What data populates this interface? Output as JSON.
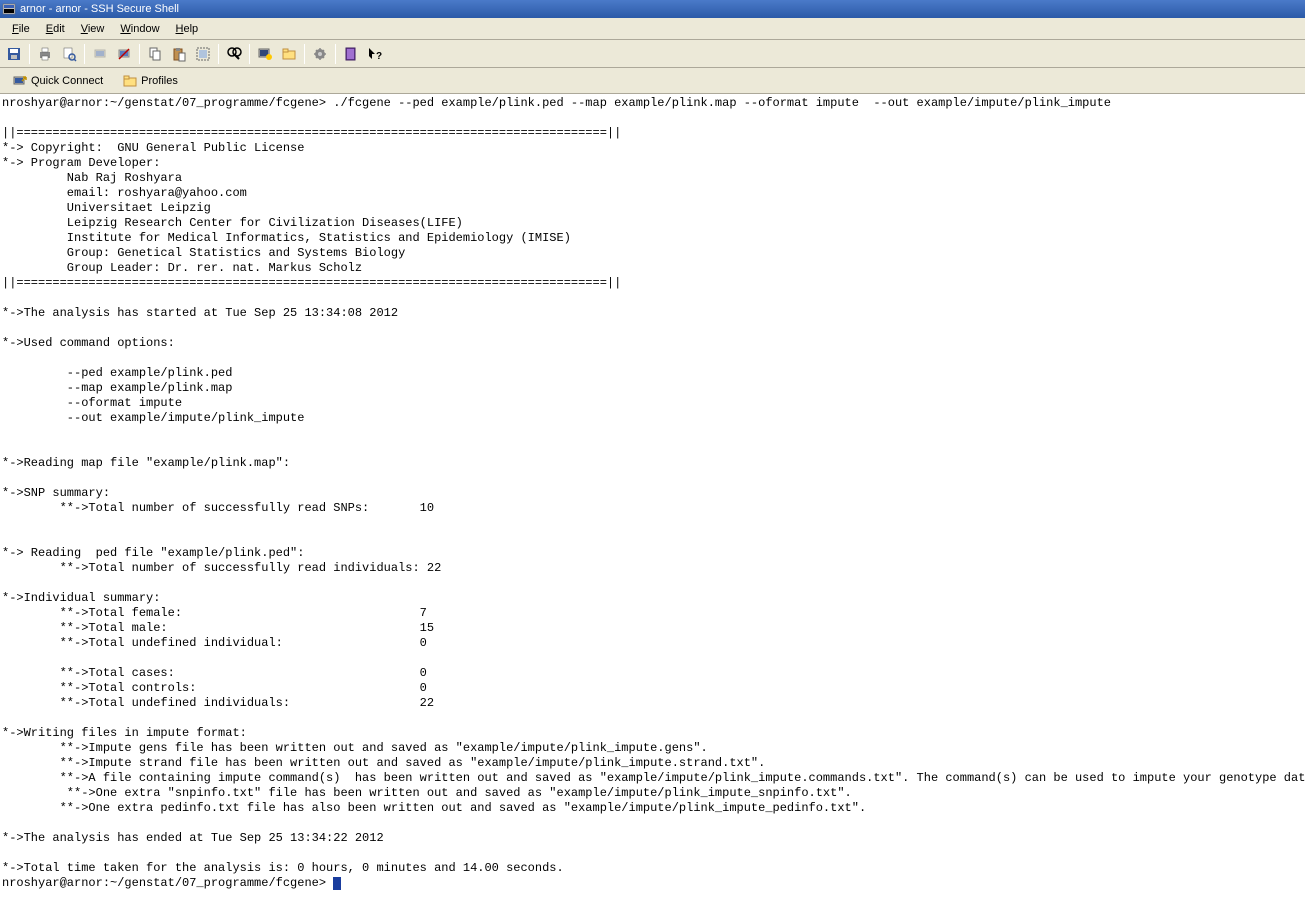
{
  "title": "arnor - arnor - SSH Secure Shell",
  "menu": {
    "file": "File",
    "edit": "Edit",
    "view": "View",
    "window": "Window",
    "help": "Help"
  },
  "toolbar2": {
    "quick_connect": "Quick Connect",
    "profiles": "Profiles"
  },
  "terminal_lines": [
    "nroshyar@arnor:~/genstat/07_programme/fcgene> ./fcgene --ped example/plink.ped --map example/plink.map --oformat impute  --out example/impute/plink_impute",
    "",
    "||==================================================================================||",
    "*-> Copyright:  GNU General Public License",
    "*-> Program Developer:",
    "         Nab Raj Roshyara",
    "         email: roshyara@yahoo.com",
    "         Universitaet Leipzig",
    "         Leipzig Research Center for Civilization Diseases(LIFE)",
    "         Institute for Medical Informatics, Statistics and Epidemiology (IMISE)",
    "         Group: Genetical Statistics and Systems Biology",
    "         Group Leader: Dr. rer. nat. Markus Scholz",
    "||==================================================================================||",
    "",
    "*->The analysis has started at Tue Sep 25 13:34:08 2012",
    "",
    "*->Used command options:",
    "",
    "         --ped example/plink.ped",
    "         --map example/plink.map",
    "         --oformat impute",
    "         --out example/impute/plink_impute",
    "",
    "",
    "*->Reading map file \"example/plink.map\":",
    "",
    "*->SNP summary:",
    "        **->Total number of successfully read SNPs:       10",
    "",
    "",
    "*-> Reading  ped file \"example/plink.ped\":",
    "        **->Total number of successfully read individuals: 22",
    "",
    "*->Individual summary:",
    "        **->Total female:                                 7",
    "        **->Total male:                                   15",
    "        **->Total undefined individual:                   0",
    "",
    "        **->Total cases:                                  0",
    "        **->Total controls:                               0",
    "        **->Total undefined individuals:                  22",
    "",
    "*->Writing files in impute format:",
    "        **->Impute gens file has been written out and saved as \"example/impute/plink_impute.gens\".",
    "        **->Impute strand file has been written out and saved as \"example/impute/plink_impute.strand.txt\".",
    "        **->A file containing impute command(s)  has been written out and saved as \"example/impute/plink_impute.commands.txt\". The command(s) can be used to impute your genotype data.",
    "         **->One extra \"snpinfo.txt\" file has been written out and saved as \"example/impute/plink_impute_snpinfo.txt\".",
    "        **->One extra pedinfo.txt file has also been written out and saved as \"example/impute/plink_impute_pedinfo.txt\".",
    "",
    "*->The analysis has ended at Tue Sep 25 13:34:22 2012",
    "",
    "*->Total time taken for the analysis is: 0 hours, 0 minutes and 14.00 seconds.",
    "nroshyar@arnor:~/genstat/07_programme/fcgene> "
  ]
}
